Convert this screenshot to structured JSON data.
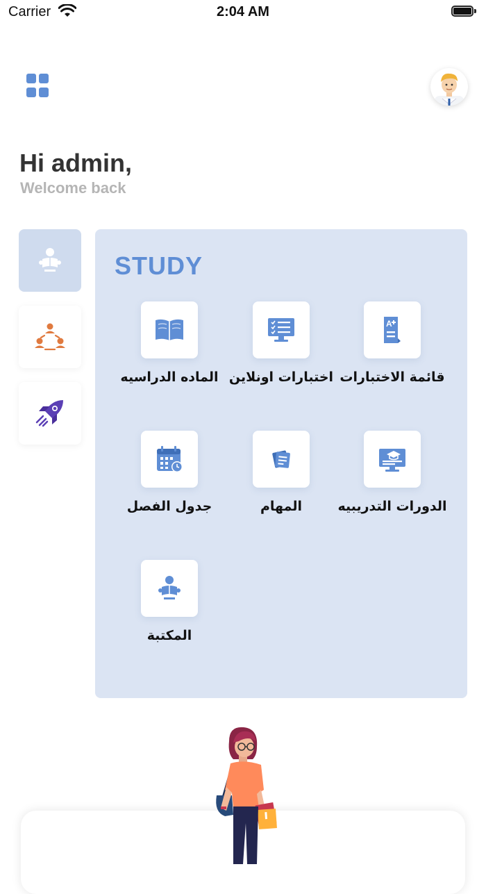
{
  "status_bar": {
    "carrier": "Carrier",
    "time": "2:04 AM"
  },
  "header": {
    "menu_icon": "grid-icon",
    "avatar_icon": "user-avatar-icon"
  },
  "greeting": {
    "title": "Hi admin,",
    "subtitle": "Welcome back"
  },
  "categories": [
    {
      "name": "study",
      "icon": "reading-person-icon",
      "active": true
    },
    {
      "name": "community",
      "icon": "people-network-icon",
      "active": false
    },
    {
      "name": "launch",
      "icon": "rocket-icon",
      "active": false
    }
  ],
  "study": {
    "title": "STUDY",
    "tiles": [
      {
        "label": "قائمة الاختبارات",
        "icon": "exam-grade-icon"
      },
      {
        "label": "اختبارات اونلاين",
        "icon": "online-exam-icon"
      },
      {
        "label": "الماده الدراسيه",
        "icon": "book-icon"
      },
      {
        "label": "الدورات التدريبيه",
        "icon": "training-course-icon"
      },
      {
        "label": "المهام",
        "icon": "tasks-icon"
      },
      {
        "label": "جدول الفصل",
        "icon": "calendar-icon"
      },
      {
        "label": "المكتبة",
        "icon": "library-icon"
      }
    ]
  },
  "colors": {
    "accent": "#5f8ed5",
    "panel": "#dbe4f3",
    "active_tab": "#cfdbee",
    "orange": "#e07a3f",
    "purple": "#5b3fb5"
  }
}
